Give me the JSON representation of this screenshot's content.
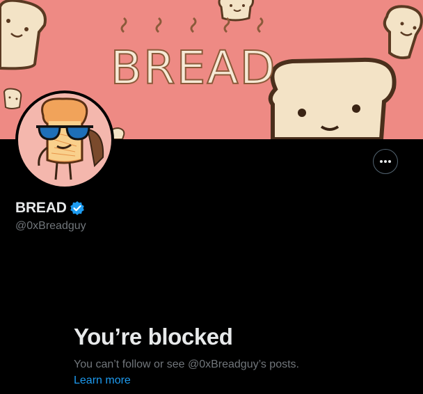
{
  "banner": {
    "title": "BREAD",
    "background": "#ee8a84"
  },
  "profile": {
    "display_name": "BREAD",
    "handle": "@0xBreadguy",
    "verified_color": "#1d9bf0",
    "avatar_icon": "toast-with-sunglasses-avatar"
  },
  "actions": {
    "more_icon": "ellipsis-icon"
  },
  "blocked": {
    "title": "You’re blocked",
    "message": "You can’t follow or see @0xBreadguy’s posts.",
    "link": "Learn more",
    "link_color": "#1d9bf0"
  }
}
